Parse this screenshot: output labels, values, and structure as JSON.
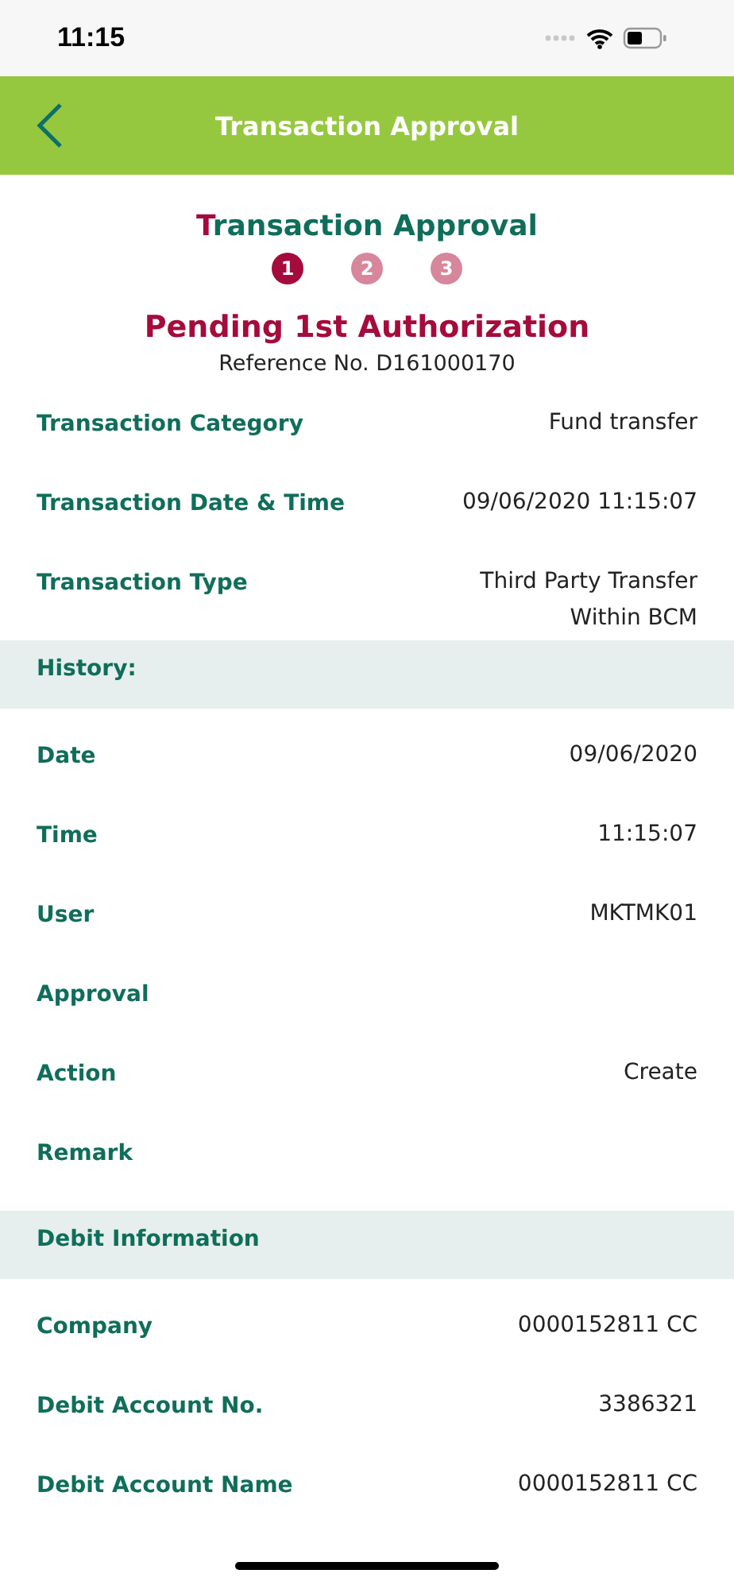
{
  "status_bar": {
    "time": "11:15"
  },
  "header": {
    "title": "Transaction Approval"
  },
  "summary": {
    "title": "Transaction Approval",
    "steps": [
      {
        "label": "1",
        "selected": true
      },
      {
        "label": "2",
        "selected": false
      },
      {
        "label": "3",
        "selected": false
      }
    ],
    "status": "Pending 1st Authorization",
    "reference": "Reference No. D161000170"
  },
  "details": [
    {
      "label": "Transaction Category",
      "value": "Fund transfer"
    },
    {
      "label": "Transaction Date & Time",
      "value": "09/06/2020 11:15:07"
    },
    {
      "label": "Transaction Type",
      "value": "Third Party Transfer\nWithin BCM"
    }
  ],
  "sections": [
    {
      "title": "History:",
      "rows": [
        {
          "label": "Date",
          "value": "09/06/2020"
        },
        {
          "label": "Time",
          "value": "11:15:07"
        },
        {
          "label": "User",
          "value": "MKTMK01"
        },
        {
          "label": "Approval"
        },
        {
          "label": "Action",
          "value": "Create"
        },
        {
          "label": "Remark"
        }
      ]
    },
    {
      "title": "Debit Information",
      "rows": [
        {
          "label": "Company",
          "value": "0000152811 CC"
        },
        {
          "label": "Debit Account No.",
          "value": "3386321"
        },
        {
          "label": "Debit Account Name",
          "value": "0000152811 CC"
        }
      ]
    }
  ]
}
